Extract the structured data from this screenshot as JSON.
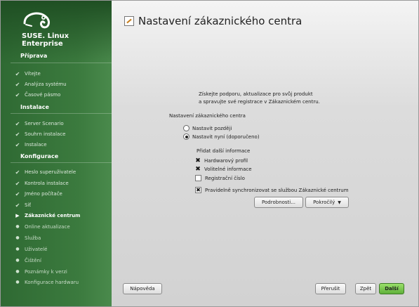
{
  "brand": {
    "line1": "SUSE. Linux",
    "line2": "Enterprise"
  },
  "sidebar": {
    "sections": [
      {
        "title": "Příprava",
        "steps": [
          {
            "label": "Vítejte",
            "state": "done"
          },
          {
            "label": "Analýza systému",
            "state": "done"
          },
          {
            "label": "Časové pásmo",
            "state": "done"
          }
        ]
      },
      {
        "title": "Instalace",
        "steps": [
          {
            "label": "Server Scenario",
            "state": "done"
          },
          {
            "label": "Souhrn instalace",
            "state": "done"
          },
          {
            "label": "Instalace",
            "state": "done"
          }
        ]
      },
      {
        "title": "Konfigurace",
        "steps": [
          {
            "label": "Heslo superuživatele",
            "state": "done"
          },
          {
            "label": "Kontrola instalace",
            "state": "done"
          },
          {
            "label": "Jméno počítače",
            "state": "done"
          },
          {
            "label": "Síť",
            "state": "done"
          },
          {
            "label": "Zákaznické centrum",
            "state": "current"
          },
          {
            "label": "Online aktualizace",
            "state": "pending"
          },
          {
            "label": "Služba",
            "state": "pending"
          },
          {
            "label": "Uživatelé",
            "state": "pending"
          },
          {
            "label": "Čištění",
            "state": "pending"
          },
          {
            "label": "Poznámky k verzi",
            "state": "pending"
          },
          {
            "label": "Konfigurace hardwaru",
            "state": "pending"
          }
        ]
      }
    ]
  },
  "main": {
    "title": "Nastavení zákaznického centra",
    "intro_line1": "Získejte podporu, aktualizace pro svůj produkt",
    "intro_line2": "a spravujte své registrace v Zákaznickém centru.",
    "settings_label": "Nastavení zákaznického centra",
    "radio_later": "Nastavit později",
    "radio_now": "Nastavit nyní (doporučeno)",
    "extra_label": "Přidat další informace",
    "check_hw": "Hardwarový profil",
    "check_opt": "Volitelné informace",
    "check_reg": "Registrační číslo",
    "check_sync": "Pravidelně synchronizovat se službou Zákaznické centrum",
    "details_button": "Podrobnosti...",
    "advanced_button": "Pokročilý"
  },
  "footer": {
    "help": "Nápověda",
    "abort": "Přerušit",
    "back": "Zpět",
    "next": "Další"
  }
}
